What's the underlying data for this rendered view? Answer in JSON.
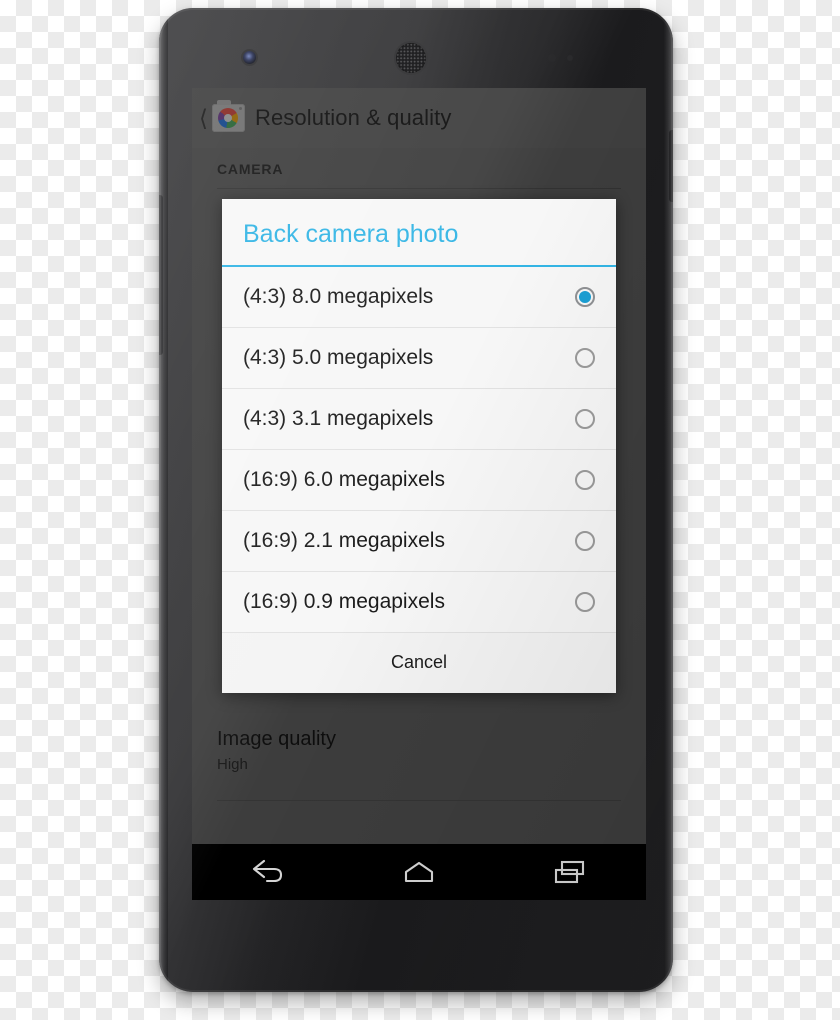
{
  "device": {
    "name": "android-phone-mockup",
    "hardware": {
      "front_camera_icon": "front-camera-icon",
      "earpiece_icon": "earpiece-speaker-icon",
      "proximity_sensor_icon": "proximity-sensor-icon",
      "light_sensor_icon": "light-sensor-icon",
      "volume_button": "volume-rocker",
      "power_button": "power-button"
    }
  },
  "settings_screen": {
    "actionbar": {
      "back_icon": "back-chevron-icon",
      "app_icon": "camera-app-icon",
      "title": "Resolution & quality"
    },
    "section_header": "CAMERA",
    "preference": {
      "title": "Image quality",
      "summary": "High"
    }
  },
  "dialog": {
    "title": "Back camera photo",
    "accent_color": "#33b5e5",
    "background_color": "#f7f7f7",
    "selected_index": 0,
    "options": [
      {
        "label": "(4:3) 8.0 megapixels",
        "selected": true
      },
      {
        "label": "(4:3) 5.0 megapixels",
        "selected": false
      },
      {
        "label": "(4:3) 3.1 megapixels",
        "selected": false
      },
      {
        "label": "(16:9) 6.0 megapixels",
        "selected": false
      },
      {
        "label": "(16:9) 2.1 megapixels",
        "selected": false
      },
      {
        "label": "(16:9) 0.9 megapixels",
        "selected": false
      }
    ],
    "cancel_label": "Cancel"
  },
  "navbar": {
    "back_icon": "back-arrow-icon",
    "home_icon": "home-icon",
    "recents_icon": "recent-apps-icon"
  }
}
